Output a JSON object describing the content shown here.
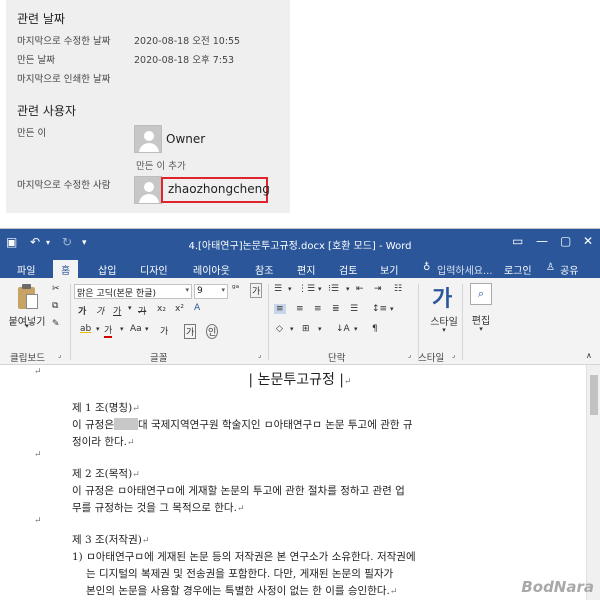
{
  "properties": {
    "dates_heading": "관련 날짜",
    "dates": [
      {
        "label": "마지막으로 수정한 날짜",
        "value": "2020-08-18 오전 10:55"
      },
      {
        "label": "만든 날짜",
        "value": "2020-08-18 오후 7:53"
      },
      {
        "label": "마지막으로 인쇄한 날짜",
        "value": ""
      }
    ],
    "users_heading": "관련 사용자",
    "creator_label": "만든 이",
    "creator_name": "Owner",
    "add_author": "만든 이 추가",
    "last_modified_by_label": "마지막으로 수정한 사람",
    "last_modified_by_name": "zhaozhongcheng",
    "highlight_color": "#e0242c"
  },
  "word": {
    "title": "4.[아태연구]논문투고규정.docx [호환 모드] - Word",
    "accent_color": "#2b579a",
    "tabs": [
      "파일",
      "홈",
      "삽입",
      "디자인",
      "레이아웃",
      "참조",
      "편지",
      "검토",
      "보기"
    ],
    "active_tab": "홈",
    "tell_me": "입력하세요...",
    "login": "로그인",
    "share": "공유",
    "ribbon": {
      "paste_label": "붙여넣기",
      "font_name": "맑은 고딕(본문 한글)",
      "font_size": "9",
      "style_label": "스타일",
      "edit_label": "편집",
      "groups": [
        "클립보드",
        "글꼴",
        "단락",
        "스타일"
      ]
    },
    "document": {
      "title": "| 논문투고규정 |",
      "sections": [
        {
          "heading": "제 1 조(명칭)",
          "lines": [
            "이 규정은",
            "대 국제지역연구원 학술지인 ㅁ아태연구ㅁ 논문 투고에 관한 규",
            "정이라 한다."
          ]
        },
        {
          "heading": "제 2 조(목적)",
          "lines": [
            "이 규정은 ㅁ아태연구ㅁ에 게재할 논문의 투고에 관한 절차를 정하고 관련 업",
            "무를 규정하는 것을 그 목적으로 한다."
          ]
        },
        {
          "heading": "제 3 조(저작권)",
          "lines": [
            "1) ㅁ아태연구ㅁ에 게재된 논문 등의 저작권은 본 연구소가 소유한다. 저작권에",
            "는 디지털의 복제권 및 전송권을 포함한다. 다만, 게재된 논문의 필자가",
            "본인의 논문을 사용할 경우에는 특별한 사정이 없는 한 이를 승인한다."
          ]
        }
      ]
    }
  },
  "watermark": "BodNara"
}
